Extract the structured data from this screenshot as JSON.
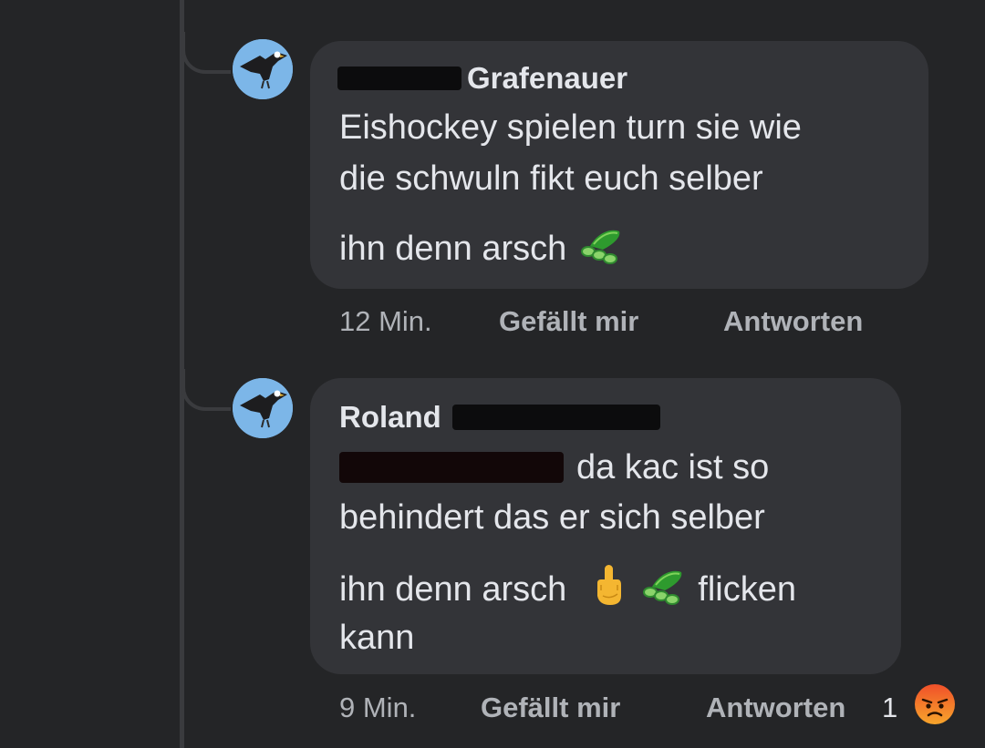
{
  "comments": [
    {
      "author": "Grafenauer",
      "lines": [
        "Eishockey  spielen turn sie wie",
        "die  schwuln fikt euch selber",
        "ihn denn arsch"
      ],
      "time": "12 Min.",
      "like_label": "Gefällt mir",
      "reply_label": "Antworten"
    },
    {
      "author": "Roland",
      "lines": [
        "da kac ist  so",
        "behindert das er sich  selber",
        "ihn denn arsch",
        "flicken",
        "kann"
      ],
      "time": "9 Min.",
      "like_label": "Gefällt mir",
      "reply_label": "Antworten",
      "reaction_count": "1"
    }
  ],
  "icons": {
    "avatar": "eagle-avatar",
    "cucumber": "cucumber-emoji",
    "middle_finger": "middle-finger-emoji",
    "reaction": "angry-face-emoji"
  },
  "colors": {
    "background": "#242527",
    "bubble": "#333438",
    "text": "#e4e6eb",
    "meta": "#b0b3b8",
    "redaction": "#0c0c0d"
  }
}
